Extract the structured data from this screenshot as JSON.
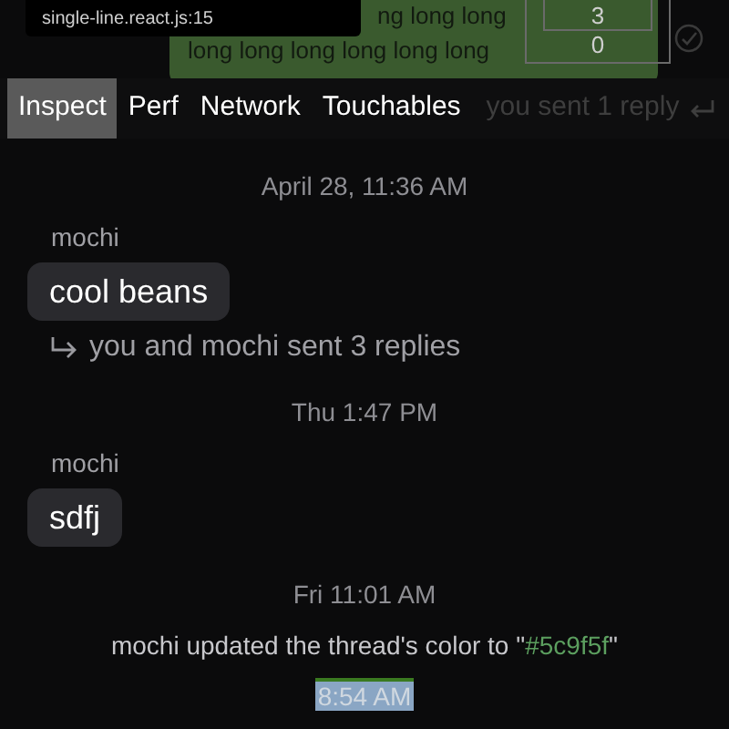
{
  "inspector_label": "single-line.react.js:15",
  "background_bubble": {
    "lines": [
      "ng long long",
      "long long long long long long"
    ]
  },
  "box_values": [
    "3",
    "0"
  ],
  "behind_reply": "you sent 1 reply",
  "tabs": [
    {
      "label": "Inspect",
      "selected": true
    },
    {
      "label": "Perf",
      "selected": false
    },
    {
      "label": "Network",
      "selected": false
    },
    {
      "label": "Touchables",
      "selected": false
    }
  ],
  "items": [
    {
      "kind": "time",
      "text": "April 28, 11:36 AM"
    },
    {
      "kind": "message",
      "sender": "mochi",
      "text": "cool beans",
      "replies": "you and mochi sent 3 replies"
    },
    {
      "kind": "time",
      "text": "Thu 1:47 PM"
    },
    {
      "kind": "message",
      "sender": "mochi",
      "text": "sdfj"
    },
    {
      "kind": "time",
      "text": "Fri 11:01 AM"
    },
    {
      "kind": "system",
      "text": "mochi updated the thread's color to \"",
      "color_value": "#5c9f5f",
      "suffix": "\""
    },
    {
      "kind": "highlight_time",
      "text": "8:54 AM"
    }
  ]
}
